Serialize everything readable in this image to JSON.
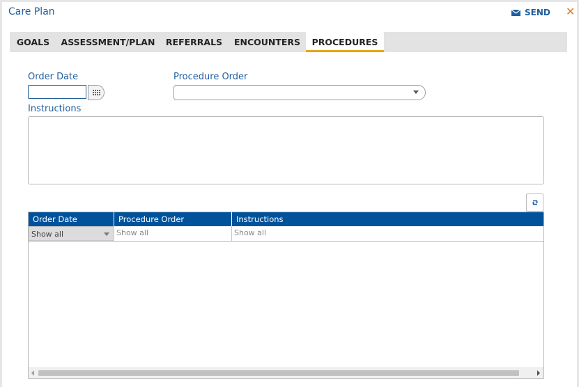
{
  "window": {
    "title": "Care Plan",
    "send_label": "SEND",
    "close_glyph": "✕"
  },
  "tabs": [
    {
      "label": "GOALS",
      "active": false
    },
    {
      "label": "ASSESSMENT/PLAN",
      "active": false
    },
    {
      "label": "REFERRALS",
      "active": false
    },
    {
      "label": "ENCOUNTERS",
      "active": false
    },
    {
      "label": "PROCEDURES",
      "active": true
    }
  ],
  "form": {
    "order_date_label": "Order Date",
    "order_date_value": "",
    "procedure_order_label": "Procedure Order",
    "procedure_order_value": "",
    "instructions_label": "Instructions",
    "instructions_value": ""
  },
  "grid": {
    "columns": [
      "Order Date",
      "Procedure Order",
      "Instructions"
    ],
    "filters": [
      "Show all",
      "Show all",
      "Show all"
    ],
    "rows": []
  },
  "colors": {
    "accent": "#1f5f9e",
    "header_bg": "#00529b",
    "tab_underline": "#e8a317",
    "close": "#e0781e"
  }
}
